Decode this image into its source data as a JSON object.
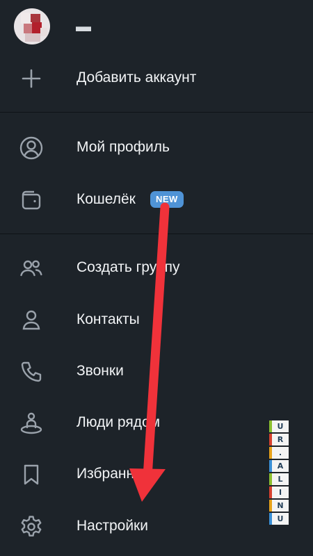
{
  "header": {
    "username": "▬",
    "avatar": "avatar-icon"
  },
  "menu": {
    "add_account": {
      "label": "Добавить аккаунт",
      "icon": "plus-icon"
    },
    "profile": {
      "label": "Мой профиль",
      "icon": "user-circle-icon"
    },
    "wallet": {
      "label": "Кошелёк",
      "icon": "wallet-icon",
      "badge": "NEW"
    },
    "create_group": {
      "label": "Создать группу",
      "icon": "users-icon"
    },
    "contacts": {
      "label": "Контакты",
      "icon": "user-icon"
    },
    "calls": {
      "label": "Звонки",
      "icon": "phone-icon"
    },
    "people_nearby": {
      "label": "Люди рядом",
      "icon": "people-nearby-icon"
    },
    "saved": {
      "label": "Избранное",
      "icon": "bookmark-icon"
    },
    "settings": {
      "label": "Настройки",
      "icon": "gear-icon"
    }
  },
  "watermark": {
    "letters": [
      "U",
      "N",
      "I",
      "L",
      "A",
      ".",
      "R",
      "U"
    ]
  },
  "colors": {
    "background": "#1d2329",
    "text": "#f2f4f6",
    "icon": "#9aa2ab",
    "badge": "#4f93d6",
    "arrow": "#f0323a"
  }
}
